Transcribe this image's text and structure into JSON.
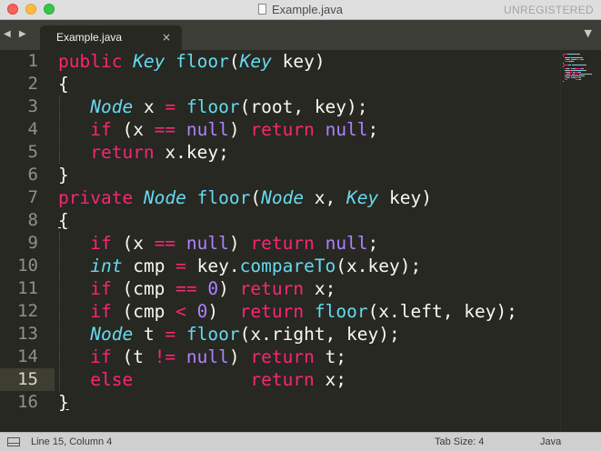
{
  "window": {
    "title": "Example.java",
    "badge": "UNREGISTERED"
  },
  "tabbar": {
    "nav_arrows": "◀ ▶",
    "active_tab": "Example.java",
    "tab_close": "×",
    "dropdown": "▼"
  },
  "editor": {
    "current_line": 15,
    "lines": [
      {
        "n": "1",
        "tokens": [
          {
            "t": "public ",
            "c": "kw"
          },
          {
            "t": "Key",
            "c": "ty"
          },
          {
            "t": " ",
            "c": ""
          },
          {
            "t": "floor",
            "c": "fn"
          },
          {
            "t": "(",
            "c": ""
          },
          {
            "t": "Key",
            "c": "ty"
          },
          {
            "t": " key)",
            "c": ""
          }
        ]
      },
      {
        "n": "2",
        "tokens": [
          {
            "t": "{",
            "c": ""
          }
        ]
      },
      {
        "n": "3",
        "tokens": [
          {
            "t": "   ",
            "c": ""
          },
          {
            "t": "Node",
            "c": "ty"
          },
          {
            "t": " x ",
            "c": ""
          },
          {
            "t": "=",
            "c": "kw"
          },
          {
            "t": " ",
            "c": ""
          },
          {
            "t": "floor",
            "c": "fn"
          },
          {
            "t": "(root, key);",
            "c": ""
          }
        ]
      },
      {
        "n": "4",
        "tokens": [
          {
            "t": "   ",
            "c": ""
          },
          {
            "t": "if",
            "c": "kw"
          },
          {
            "t": " (x ",
            "c": ""
          },
          {
            "t": "==",
            "c": "kw"
          },
          {
            "t": " ",
            "c": ""
          },
          {
            "t": "null",
            "c": "cn"
          },
          {
            "t": ") ",
            "c": ""
          },
          {
            "t": "return",
            "c": "kw"
          },
          {
            "t": " ",
            "c": ""
          },
          {
            "t": "null",
            "c": "cn"
          },
          {
            "t": ";",
            "c": ""
          }
        ]
      },
      {
        "n": "5",
        "tokens": [
          {
            "t": "   ",
            "c": ""
          },
          {
            "t": "return",
            "c": "kw"
          },
          {
            "t": " x.key;",
            "c": ""
          }
        ]
      },
      {
        "n": "6",
        "tokens": [
          {
            "t": "}",
            "c": ""
          }
        ]
      },
      {
        "n": "7",
        "tokens": [
          {
            "t": "private ",
            "c": "kw"
          },
          {
            "t": "Node",
            "c": "ty"
          },
          {
            "t": " ",
            "c": ""
          },
          {
            "t": "floor",
            "c": "fn"
          },
          {
            "t": "(",
            "c": ""
          },
          {
            "t": "Node",
            "c": "ty"
          },
          {
            "t": " x, ",
            "c": ""
          },
          {
            "t": "Key",
            "c": "ty"
          },
          {
            "t": " key)",
            "c": ""
          }
        ]
      },
      {
        "n": "8",
        "tokens": [
          {
            "t": "{",
            "c": "brace-u"
          }
        ]
      },
      {
        "n": "9",
        "tokens": [
          {
            "t": "   ",
            "c": ""
          },
          {
            "t": "if",
            "c": "kw"
          },
          {
            "t": " (x ",
            "c": ""
          },
          {
            "t": "==",
            "c": "kw"
          },
          {
            "t": " ",
            "c": ""
          },
          {
            "t": "null",
            "c": "cn"
          },
          {
            "t": ") ",
            "c": ""
          },
          {
            "t": "return",
            "c": "kw"
          },
          {
            "t": " ",
            "c": ""
          },
          {
            "t": "null",
            "c": "cn"
          },
          {
            "t": ";",
            "c": ""
          }
        ]
      },
      {
        "n": "10",
        "tokens": [
          {
            "t": "   ",
            "c": ""
          },
          {
            "t": "int",
            "c": "ty"
          },
          {
            "t": " cmp ",
            "c": ""
          },
          {
            "t": "=",
            "c": "kw"
          },
          {
            "t": " key.",
            "c": ""
          },
          {
            "t": "compareTo",
            "c": "fn"
          },
          {
            "t": "(x.key);",
            "c": ""
          }
        ]
      },
      {
        "n": "11",
        "tokens": [
          {
            "t": "   ",
            "c": ""
          },
          {
            "t": "if",
            "c": "kw"
          },
          {
            "t": " (cmp ",
            "c": ""
          },
          {
            "t": "==",
            "c": "kw"
          },
          {
            "t": " ",
            "c": ""
          },
          {
            "t": "0",
            "c": "cn"
          },
          {
            "t": ") ",
            "c": ""
          },
          {
            "t": "return",
            "c": "kw"
          },
          {
            "t": " x;",
            "c": ""
          }
        ]
      },
      {
        "n": "12",
        "tokens": [
          {
            "t": "   ",
            "c": ""
          },
          {
            "t": "if",
            "c": "kw"
          },
          {
            "t": " (cmp ",
            "c": ""
          },
          {
            "t": "<",
            "c": "kw"
          },
          {
            "t": " ",
            "c": ""
          },
          {
            "t": "0",
            "c": "cn"
          },
          {
            "t": ")  ",
            "c": ""
          },
          {
            "t": "return",
            "c": "kw"
          },
          {
            "t": " ",
            "c": ""
          },
          {
            "t": "floor",
            "c": "fn"
          },
          {
            "t": "(x.left, key);",
            "c": ""
          }
        ]
      },
      {
        "n": "13",
        "tokens": [
          {
            "t": "   ",
            "c": ""
          },
          {
            "t": "Node",
            "c": "ty"
          },
          {
            "t": " t ",
            "c": ""
          },
          {
            "t": "=",
            "c": "kw"
          },
          {
            "t": " ",
            "c": ""
          },
          {
            "t": "floor",
            "c": "fn"
          },
          {
            "t": "(x.right, key);",
            "c": ""
          }
        ]
      },
      {
        "n": "14",
        "tokens": [
          {
            "t": "   ",
            "c": ""
          },
          {
            "t": "if",
            "c": "kw"
          },
          {
            "t": " (t ",
            "c": ""
          },
          {
            "t": "!=",
            "c": "kw"
          },
          {
            "t": " ",
            "c": ""
          },
          {
            "t": "null",
            "c": "cn"
          },
          {
            "t": ") ",
            "c": ""
          },
          {
            "t": "return",
            "c": "kw"
          },
          {
            "t": " t;",
            "c": ""
          }
        ]
      },
      {
        "n": "15",
        "tokens": [
          {
            "t": "   ",
            "c": ""
          },
          {
            "t": "else",
            "c": "kw"
          },
          {
            "t": "           ",
            "c": ""
          },
          {
            "t": "return",
            "c": "kw"
          },
          {
            "t": " x;",
            "c": ""
          }
        ]
      },
      {
        "n": "16",
        "tokens": [
          {
            "t": "}",
            "c": "brace-u"
          }
        ]
      }
    ]
  },
  "statusbar": {
    "position": "Line 15, Column 4",
    "tab_size": "Tab Size: 4",
    "syntax": "Java"
  },
  "colors": {
    "background": "#272822",
    "keyword": "#f92672",
    "type": "#66d9ef",
    "constant": "#ae81ff",
    "text": "#f8f8f2"
  }
}
